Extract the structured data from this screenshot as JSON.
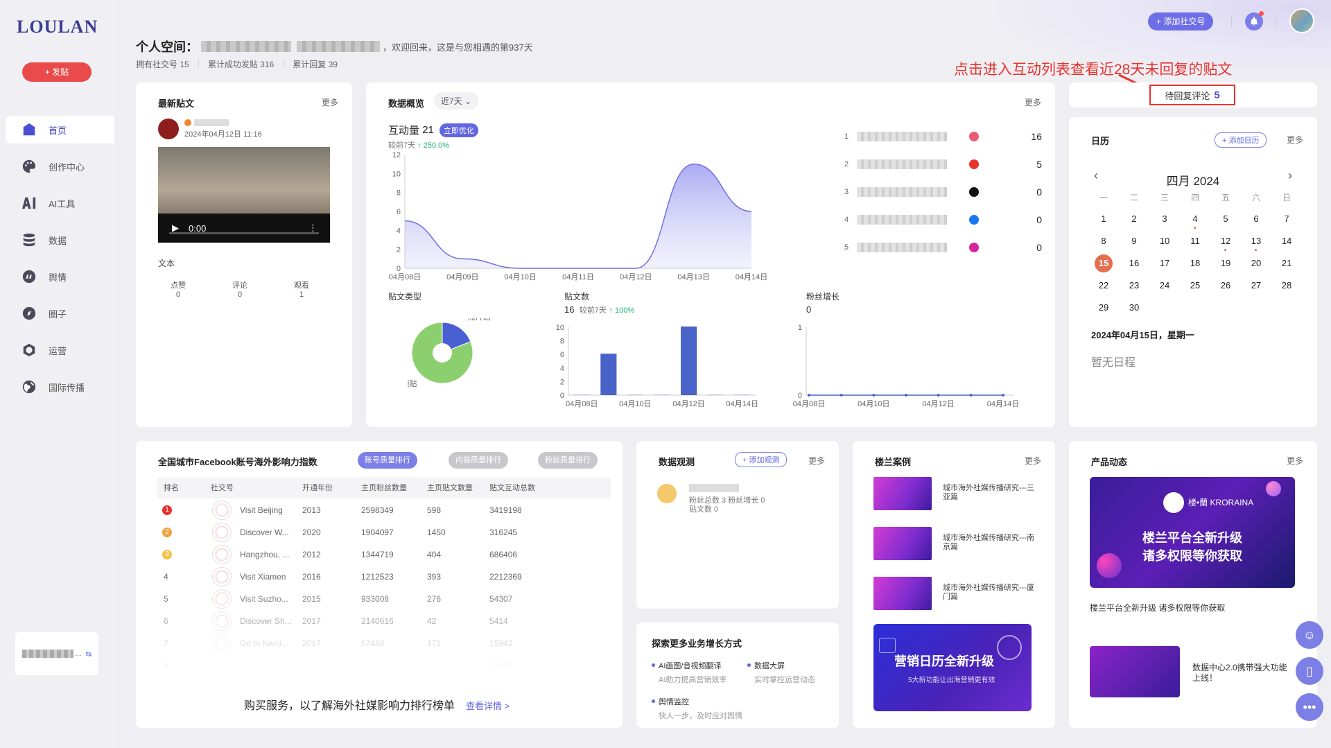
{
  "app": {
    "logo": "LOULAN",
    "post_button": "+ 发贴"
  },
  "sidebar": {
    "items": [
      {
        "label": "首页",
        "icon": "home-icon"
      },
      {
        "label": "创作中心",
        "icon": "palette-icon"
      },
      {
        "label": "AI工具",
        "icon": "ai-icon"
      },
      {
        "label": "数据",
        "icon": "database-icon"
      },
      {
        "label": "舆情",
        "icon": "quote-icon"
      },
      {
        "label": "圈子",
        "icon": "compass-icon"
      },
      {
        "label": "运营",
        "icon": "operations-icon"
      },
      {
        "label": "国际传播",
        "icon": "globe-icon"
      }
    ],
    "account_card": "..."
  },
  "header": {
    "greeting_prefix": "个人空间：",
    "greeting_suffix": "，欢迎回来，这是与您相遇的第937天",
    "stat_accounts": "拥有社交号 15",
    "stat_posts": "累计成功发贴 316",
    "stat_replies": "累计回复 39",
    "add_social_button": "+ 添加社交号"
  },
  "annotation": "点击进入互动列表查看近28天未回复的贴文",
  "pending": {
    "label": "待回复评论",
    "count": "5"
  },
  "latest_post": {
    "title": "最新贴文",
    "more": "更多",
    "date": "2024年04月12日 11:16",
    "video_time": "0:00",
    "text": "文本",
    "stats": [
      {
        "label": "点赞",
        "value": "0"
      },
      {
        "label": "评论",
        "value": "0"
      },
      {
        "label": "观看",
        "value": "1"
      }
    ]
  },
  "overview": {
    "title": "数据概览",
    "range": "近7天",
    "more": "更多",
    "kpi_label": "互动量",
    "kpi_value": "21",
    "optimize_button": "立即优化",
    "kpi_compare": "较前7天",
    "kpi_change": "↑ 250.0%",
    "ranking": [
      {
        "rank": "1",
        "value": "16",
        "color": "#e85d75"
      },
      {
        "rank": "2",
        "value": "5",
        "color": "#e8322c"
      },
      {
        "rank": "3",
        "value": "0",
        "color": "#111111"
      },
      {
        "rank": "4",
        "value": "0",
        "color": "#1877f2"
      },
      {
        "rank": "5",
        "value": "0",
        "color": "#d6249f"
      }
    ],
    "post_type_title": "贴文类型",
    "post_count_title": "贴文数",
    "post_count_value": "16",
    "post_count_compare": "较前7天",
    "post_count_change": "↑ 100%",
    "fans_title": "粉丝增长",
    "fans_value": "0"
  },
  "chart_data": [
    {
      "type": "area",
      "title": "互动量",
      "x": [
        "04月08日",
        "04月09日",
        "04月10日",
        "04月11日",
        "04月12日",
        "04月13日",
        "04月14日"
      ],
      "values": [
        5,
        1,
        0,
        0,
        0,
        11,
        6
      ],
      "ylim": [
        0,
        12
      ],
      "yticks": [
        0,
        2,
        4,
        6,
        8,
        10,
        12
      ]
    },
    {
      "type": "pie",
      "title": "贴文类型",
      "labels": [
        "照片贴",
        "视频贴"
      ],
      "values": [
        19,
        81
      ]
    },
    {
      "type": "bar",
      "title": "贴文数",
      "categories": [
        "04月08日",
        "04月09日",
        "04月10日",
        "04月11日",
        "04月12日",
        "04月13日",
        "04月14日"
      ],
      "values": [
        0,
        6,
        0,
        0,
        10,
        0,
        0
      ],
      "xticks": [
        "04月08日",
        "04月10日",
        "04月12日",
        "04月14日"
      ],
      "ylim": [
        0,
        10
      ],
      "yticks": [
        0,
        2,
        4,
        6,
        8,
        10
      ]
    },
    {
      "type": "line",
      "title": "粉丝增长",
      "x": [
        "04月08日",
        "04月09日",
        "04月10日",
        "04月11日",
        "04月12日",
        "04月13日",
        "04月14日"
      ],
      "xticks": [
        "04月08日",
        "04月10日",
        "04月12日",
        "04月14日"
      ],
      "values": [
        0,
        0,
        0,
        0,
        0,
        0,
        0
      ],
      "ylim": [
        0,
        1
      ],
      "yticks": [
        0,
        1
      ]
    }
  ],
  "calendar": {
    "title": "日历",
    "add_button": "+ 添加日历",
    "more": "更多",
    "month": "四月 2024",
    "weekdays": [
      "一",
      "二",
      "三",
      "四",
      "五",
      "六",
      "日"
    ],
    "days": [
      "1",
      "2",
      "3",
      "4",
      "5",
      "6",
      "7",
      "8",
      "9",
      "10",
      "11",
      "12",
      "13",
      "14",
      "15",
      "16",
      "17",
      "18",
      "19",
      "20",
      "21",
      "22",
      "23",
      "24",
      "25",
      "26",
      "27",
      "28",
      "29",
      "30"
    ],
    "today": "15",
    "dotted_days": [
      "4",
      "12",
      "13"
    ],
    "selected_date": "2024年04月15日，星期一",
    "empty": "暂无日程"
  },
  "ranking_table": {
    "title": "全国城市Facebook账号海外影响力指数",
    "tabs": [
      "账号质量排行",
      "内容质量排行",
      "粉丝质量排行"
    ],
    "columns": [
      "排名",
      "社交号",
      "开通年份",
      "主页粉丝数量",
      "主页贴文数量",
      "贴文互动总数"
    ],
    "rows": [
      [
        "1",
        "Visit Beijing",
        "2013",
        "2598349",
        "598",
        "3419198"
      ],
      [
        "2",
        "Discover W...",
        "2020",
        "1904097",
        "1450",
        "316245"
      ],
      [
        "3",
        "Hangzhou, ...",
        "2012",
        "1344719",
        "404",
        "686406"
      ],
      [
        "4",
        "Visit Xiamen",
        "2016",
        "1212523",
        "393",
        "2212369"
      ],
      [
        "5",
        "Visit Suzho...",
        "2015",
        "933008",
        "276",
        "54307"
      ],
      [
        "6",
        "Discover Sh...",
        "2017",
        "2140616",
        "42",
        "5414"
      ],
      [
        "7",
        "Go to Nanji...",
        "2017",
        "57488",
        "171",
        "15942"
      ],
      [
        "8",
        "",
        "",
        "",
        "",
        "14107"
      ]
    ],
    "buy_text": "购买服务，以了解海外社媒影响力排行榜单",
    "buy_link": "查看详情 >"
  },
  "observe": {
    "title": "数据观测",
    "add_button": "+ 添加观测",
    "more": "更多",
    "line1": "粉丝总数 3   粉丝增长 0",
    "line2": "贴文数 0"
  },
  "explore": {
    "title": "探索更多业务增长方式",
    "items": [
      {
        "title": "AI画图/音视频翻译",
        "sub": "AI助力提高营销效率"
      },
      {
        "title": "数据大屏",
        "sub": "实时掌控运营动态"
      },
      {
        "title": "舆情监控",
        "sub": "快人一步，及时应对舆情"
      }
    ]
  },
  "cases": {
    "title": "楼兰案例",
    "more": "更多",
    "items": [
      "城市海外社媒传播研究---三亚篇",
      "城市海外社媒传播研究---南京篇",
      "城市海外社媒传播研究---厦门篇"
    ],
    "banner_title": "营销日历全新升级",
    "banner_sub": "5大新功能让出海营销更有效"
  },
  "product": {
    "title": "产品动态",
    "more": "更多",
    "banner_brand": "楼•蘭 KRORAINA",
    "banner_l1": "楼兰平台全新升级",
    "banner_l2": "诸多权限等你获取",
    "caption": "楼兰平台全新升级 诸多权限等你获取",
    "second_text": "数据中心2.0携带强大功能上线！"
  }
}
